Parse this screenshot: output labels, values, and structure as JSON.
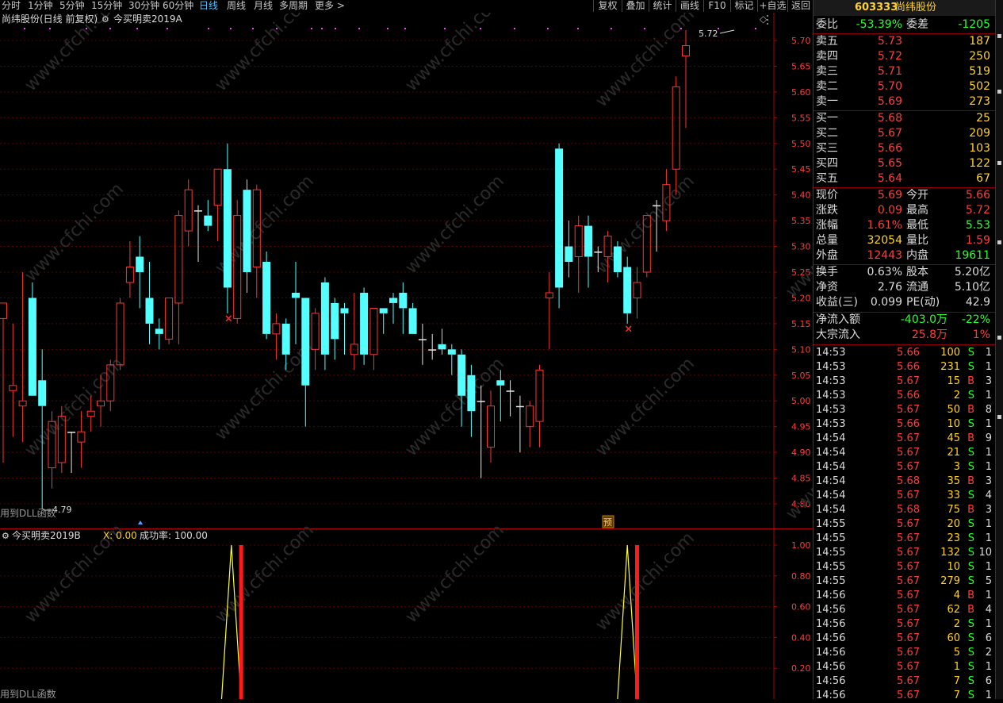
{
  "toolbar": {
    "periods": [
      "分时",
      "1分钟",
      "5分钟",
      "15分钟",
      "30分钟",
      "60分钟",
      "日线",
      "周线",
      "月线",
      "多周期",
      "更多 >"
    ],
    "active_period": "日线",
    "buttons": [
      "复权",
      "叠加",
      "统计",
      "画线",
      "F10",
      "标记",
      "+自选",
      "返回"
    ]
  },
  "main_chart": {
    "title": "尚纬股份(日线 前复权)",
    "indicator": "今买明卖2019A",
    "diamond": "◇",
    "x_mark": "×",
    "dll_label": "用到DLL函数",
    "hi_label": "5.72",
    "lo_label": "4.79",
    "yu_badge": "预"
  },
  "sub_chart": {
    "title": "今买明卖2019B",
    "x_label": "X: 0.00",
    "success_label": "成功率: 100.00",
    "dll_label": "用到DLL函数"
  },
  "chart_data": [
    {
      "type": "candlestick",
      "title": "尚纬股份(日线 前复权)",
      "ylim": [
        4.75,
        5.77
      ],
      "yticks": [
        "5.70",
        "5.65",
        "5.60",
        "5.55",
        "5.50",
        "5.45",
        "5.40",
        "5.35",
        "5.30",
        "5.25",
        "5.20",
        "5.15",
        "5.10",
        "5.05",
        "5.00",
        "4.95",
        "4.90",
        "4.85",
        "4.80"
      ],
      "colors": {
        "up": "#ff3232",
        "down": "#54ffff",
        "flat": "#e6e6e6"
      },
      "candles": [
        {
          "o": 5.16,
          "h": 5.19,
          "l": 4.88,
          "c": 5.19
        },
        {
          "o": 5.02,
          "h": 5.15,
          "l": 4.93,
          "c": 5.03
        },
        {
          "o": 4.99,
          "h": 5.25,
          "l": 4.92,
          "c": 5.0
        },
        {
          "o": 5.2,
          "h": 5.23,
          "l": 5.01,
          "c": 5.01
        },
        {
          "o": 5.04,
          "h": 5.1,
          "l": 4.79,
          "c": 4.99
        },
        {
          "o": 4.87,
          "h": 4.98,
          "l": 4.83,
          "c": 4.96
        },
        {
          "o": 4.88,
          "h": 4.99,
          "l": 4.86,
          "c": 4.97
        },
        {
          "o": 4.94,
          "h": 4.94,
          "l": 4.86,
          "c": 4.94
        },
        {
          "o": 4.92,
          "h": 4.98,
          "l": 4.87,
          "c": 4.94
        },
        {
          "o": 4.97,
          "h": 5.01,
          "l": 4.94,
          "c": 4.98
        },
        {
          "o": 4.99,
          "h": 5.05,
          "l": 4.95,
          "c": 5.0
        },
        {
          "o": 5.0,
          "h": 5.08,
          "l": 4.98,
          "c": 5.07
        },
        {
          "o": 5.07,
          "h": 5.2,
          "l": 5.06,
          "c": 5.19
        },
        {
          "o": 5.23,
          "h": 5.31,
          "l": 5.2,
          "c": 5.26
        },
        {
          "o": 5.28,
          "h": 5.32,
          "l": 5.18,
          "c": 5.25
        },
        {
          "o": 5.2,
          "h": 5.27,
          "l": 5.11,
          "c": 5.15
        },
        {
          "o": 5.14,
          "h": 5.16,
          "l": 5.1,
          "c": 5.13
        },
        {
          "o": 5.12,
          "h": 5.2,
          "l": 5.11,
          "c": 5.2
        },
        {
          "o": 5.19,
          "h": 5.37,
          "l": 5.11,
          "c": 5.36
        },
        {
          "o": 5.33,
          "h": 5.43,
          "l": 5.3,
          "c": 5.41
        },
        {
          "o": 5.37,
          "h": 5.38,
          "l": 5.27,
          "c": 5.37
        },
        {
          "o": 5.36,
          "h": 5.39,
          "l": 5.33,
          "c": 5.34
        },
        {
          "o": 5.38,
          "h": 5.45,
          "l": 5.31,
          "c": 5.45
        },
        {
          "o": 5.45,
          "h": 5.5,
          "l": 5.17,
          "c": 5.22
        },
        {
          "o": 5.16,
          "h": 5.39,
          "l": 5.15,
          "c": 5.36
        },
        {
          "o": 5.41,
          "h": 5.43,
          "l": 5.21,
          "c": 5.25
        },
        {
          "o": 5.26,
          "h": 5.42,
          "l": 5.2,
          "c": 5.41
        },
        {
          "o": 5.27,
          "h": 5.29,
          "l": 5.12,
          "c": 5.13
        },
        {
          "o": 5.13,
          "h": 5.17,
          "l": 5.08,
          "c": 5.15
        },
        {
          "o": 5.15,
          "h": 5.16,
          "l": 5.06,
          "c": 5.09
        },
        {
          "o": 5.21,
          "h": 5.27,
          "l": 5.11,
          "c": 5.2
        },
        {
          "o": 5.2,
          "h": 5.2,
          "l": 4.95,
          "c": 5.03
        },
        {
          "o": 5.1,
          "h": 5.18,
          "l": 5.06,
          "c": 5.17
        },
        {
          "o": 5.23,
          "h": 5.24,
          "l": 5.06,
          "c": 5.09
        },
        {
          "o": 5.19,
          "h": 5.2,
          "l": 5.08,
          "c": 5.12
        },
        {
          "o": 5.18,
          "h": 5.19,
          "l": 5.09,
          "c": 5.17
        },
        {
          "o": 5.09,
          "h": 5.21,
          "l": 5.06,
          "c": 5.11
        },
        {
          "o": 5.21,
          "h": 5.22,
          "l": 5.07,
          "c": 5.09
        },
        {
          "o": 5.09,
          "h": 5.18,
          "l": 5.06,
          "c": 5.18
        },
        {
          "o": 5.18,
          "h": 5.18,
          "l": 5.13,
          "c": 5.17
        },
        {
          "o": 5.2,
          "h": 5.21,
          "l": 5.15,
          "c": 5.19
        },
        {
          "o": 5.21,
          "h": 5.23,
          "l": 5.13,
          "c": 5.18
        },
        {
          "o": 5.18,
          "h": 5.19,
          "l": 5.13,
          "c": 5.13
        },
        {
          "o": 5.12,
          "h": 5.15,
          "l": 5.07,
          "c": 5.12
        },
        {
          "o": 5.1,
          "h": 5.13,
          "l": 5.08,
          "c": 5.1
        },
        {
          "o": 5.11,
          "h": 5.14,
          "l": 5.09,
          "c": 5.1
        },
        {
          "o": 5.1,
          "h": 5.11,
          "l": 5.05,
          "c": 5.09
        },
        {
          "o": 5.09,
          "h": 5.1,
          "l": 4.95,
          "c": 5.01
        },
        {
          "o": 5.05,
          "h": 5.07,
          "l": 4.93,
          "c": 4.98
        },
        {
          "o": 5.0,
          "h": 5.03,
          "l": 4.85,
          "c": 5.0
        },
        {
          "o": 4.91,
          "h": 5.02,
          "l": 4.88,
          "c": 4.99
        },
        {
          "o": 5.04,
          "h": 5.06,
          "l": 4.96,
          "c": 5.03
        },
        {
          "o": 5.02,
          "h": 5.04,
          "l": 4.97,
          "c": 5.02
        },
        {
          "o": 4.99,
          "h": 5.01,
          "l": 4.9,
          "c": 4.99
        },
        {
          "o": 4.95,
          "h": 5.0,
          "l": 4.91,
          "c": 4.99
        },
        {
          "o": 4.96,
          "h": 5.07,
          "l": 4.91,
          "c": 5.06
        },
        {
          "o": 5.2,
          "h": 5.25,
          "l": 5.1,
          "c": 5.21
        },
        {
          "o": 5.49,
          "h": 5.5,
          "l": 5.18,
          "c": 5.22
        },
        {
          "o": 5.3,
          "h": 5.35,
          "l": 5.24,
          "c": 5.27
        },
        {
          "o": 5.28,
          "h": 5.36,
          "l": 5.21,
          "c": 5.34
        },
        {
          "o": 5.34,
          "h": 5.36,
          "l": 5.22,
          "c": 5.28
        },
        {
          "o": 5.29,
          "h": 5.3,
          "l": 5.25,
          "c": 5.29
        },
        {
          "o": 5.28,
          "h": 5.33,
          "l": 5.23,
          "c": 5.32
        },
        {
          "o": 5.3,
          "h": 5.31,
          "l": 5.24,
          "c": 5.25
        },
        {
          "o": 5.26,
          "h": 5.28,
          "l": 5.15,
          "c": 5.17
        },
        {
          "o": 5.2,
          "h": 5.26,
          "l": 5.16,
          "c": 5.23
        },
        {
          "o": 5.25,
          "h": 5.36,
          "l": 5.24,
          "c": 5.36
        },
        {
          "o": 5.38,
          "h": 5.39,
          "l": 5.29,
          "c": 5.38
        },
        {
          "o": 5.35,
          "h": 5.45,
          "l": 5.33,
          "c": 5.42
        },
        {
          "o": 5.45,
          "h": 5.63,
          "l": 5.4,
          "c": 5.61
        },
        {
          "o": 5.67,
          "h": 5.72,
          "l": 5.53,
          "c": 5.69
        }
      ],
      "markers": [
        {
          "type": "x",
          "index": 23,
          "y": 5.16
        },
        {
          "type": "x",
          "index": 64,
          "y": 5.14
        }
      ]
    },
    {
      "type": "line",
      "title": "今买明卖2019B",
      "ylim": [
        0,
        1.0
      ],
      "yticks": [
        "1.00",
        "0.80",
        "0.60",
        "0.40",
        "0.20"
      ],
      "series": [
        {
          "points": [
            {
              "i": 22.4,
              "v": 0
            },
            {
              "i": 23.4,
              "v": 1
            },
            {
              "i": 24.4,
              "v": 0
            }
          ]
        },
        {
          "points": [
            {
              "i": 63.0,
              "v": 0
            },
            {
              "i": 64.0,
              "v": 1
            },
            {
              "i": 65.0,
              "v": 0
            }
          ]
        }
      ],
      "bars": [
        {
          "index": 24.4,
          "value": 1
        },
        {
          "index": 65.0,
          "value": 1
        }
      ]
    }
  ],
  "quote": {
    "code": "603333",
    "name": "尚纬股份",
    "wb_label": "委比",
    "wb_value": "-53.39%",
    "wc_label": "委差",
    "wc_value": "-1205",
    "asks": [
      {
        "label": "卖五",
        "price": "5.73",
        "vol": "187"
      },
      {
        "label": "卖四",
        "price": "5.72",
        "vol": "250"
      },
      {
        "label": "卖三",
        "price": "5.71",
        "vol": "519"
      },
      {
        "label": "卖二",
        "price": "5.70",
        "vol": "502"
      },
      {
        "label": "卖一",
        "price": "5.69",
        "vol": "273"
      }
    ],
    "bids": [
      {
        "label": "买一",
        "price": "5.68",
        "vol": "25"
      },
      {
        "label": "买二",
        "price": "5.67",
        "vol": "209"
      },
      {
        "label": "买三",
        "price": "5.66",
        "vol": "103"
      },
      {
        "label": "买四",
        "price": "5.65",
        "vol": "122"
      },
      {
        "label": "买五",
        "price": "5.64",
        "vol": "67"
      }
    ],
    "stats": [
      {
        "l1": "现价",
        "v1": "5.69",
        "c1": "red",
        "l2": "今开",
        "v2": "5.66",
        "c2": "red"
      },
      {
        "l1": "涨跌",
        "v1": "0.09",
        "c1": "red",
        "l2": "最高",
        "v2": "5.72",
        "c2": "red"
      },
      {
        "l1": "涨幅",
        "v1": "1.61%",
        "c1": "red",
        "l2": "最低",
        "v2": "5.53",
        "c2": "green"
      },
      {
        "l1": "总量",
        "v1": "32054",
        "c1": "yel",
        "l2": "量比",
        "v2": "1.59",
        "c2": "red"
      },
      {
        "l1": "外盘",
        "v1": "12443",
        "c1": "red",
        "l2": "内盘",
        "v2": "19611",
        "c2": "green"
      }
    ],
    "fundamentals": [
      {
        "l1": "换手",
        "v1": "0.63%",
        "l2": "股本",
        "v2": "5.20亿"
      },
      {
        "l1": "净资",
        "v1": "2.76",
        "l2": "流通",
        "v2": "5.10亿"
      },
      {
        "l1": "收益(三)",
        "v1": "0.099",
        "l2": "PE(动)",
        "v2": "42.9"
      }
    ],
    "flow": [
      {
        "label": "净流入额",
        "v1": "-403.0万",
        "c1": "green",
        "v2": "-22%",
        "c2": "green"
      },
      {
        "label": "大宗流入",
        "v1": "25.8万",
        "c1": "red",
        "v2": "1%",
        "c2": "red"
      }
    ],
    "trades": [
      {
        "t": "14:53",
        "p": "5.66",
        "v": "100",
        "s": "S",
        "n": "1"
      },
      {
        "t": "14:53",
        "p": "5.66",
        "v": "231",
        "s": "S",
        "n": "1"
      },
      {
        "t": "14:53",
        "p": "5.67",
        "v": "15",
        "s": "B",
        "n": "3"
      },
      {
        "t": "14:53",
        "p": "5.66",
        "v": "2",
        "s": "S",
        "n": "1"
      },
      {
        "t": "14:53",
        "p": "5.67",
        "v": "50",
        "s": "B",
        "n": "8"
      },
      {
        "t": "14:53",
        "p": "5.66",
        "v": "10",
        "s": "S",
        "n": "1"
      },
      {
        "t": "14:54",
        "p": "5.67",
        "v": "45",
        "s": "B",
        "n": "9"
      },
      {
        "t": "14:54",
        "p": "5.67",
        "v": "21",
        "s": "S",
        "n": "1"
      },
      {
        "t": "14:54",
        "p": "5.67",
        "v": "3",
        "s": "S",
        "n": "1"
      },
      {
        "t": "14:54",
        "p": "5.68",
        "v": "35",
        "s": "B",
        "n": "3"
      },
      {
        "t": "14:54",
        "p": "5.67",
        "v": "33",
        "s": "S",
        "n": "4"
      },
      {
        "t": "14:54",
        "p": "5.68",
        "v": "75",
        "s": "B",
        "n": "3"
      },
      {
        "t": "14:55",
        "p": "5.67",
        "v": "20",
        "s": "S",
        "n": "1"
      },
      {
        "t": "14:55",
        "p": "5.67",
        "v": "23",
        "s": "S",
        "n": "1"
      },
      {
        "t": "14:55",
        "p": "5.67",
        "v": "132",
        "s": "S",
        "n": "10"
      },
      {
        "t": "14:55",
        "p": "5.67",
        "v": "10",
        "s": "S",
        "n": "1"
      },
      {
        "t": "14:55",
        "p": "5.67",
        "v": "279",
        "s": "S",
        "n": "5"
      },
      {
        "t": "14:56",
        "p": "5.67",
        "v": "4",
        "s": "B",
        "n": "1"
      },
      {
        "t": "14:56",
        "p": "5.67",
        "v": "62",
        "s": "B",
        "n": "4"
      },
      {
        "t": "14:56",
        "p": "5.67",
        "v": "2",
        "s": "S",
        "n": "1"
      },
      {
        "t": "14:56",
        "p": "5.67",
        "v": "60",
        "s": "S",
        "n": "6"
      },
      {
        "t": "14:56",
        "p": "5.67",
        "v": "5",
        "s": "S",
        "n": "2"
      },
      {
        "t": "14:56",
        "p": "5.67",
        "v": "1",
        "s": "S",
        "n": "1"
      },
      {
        "t": "14:56",
        "p": "5.67",
        "v": "7",
        "s": "S",
        "n": "6"
      },
      {
        "t": "14:56",
        "p": "5.67",
        "v": "7",
        "s": "S",
        "n": "1"
      }
    ]
  },
  "watermark": "www.cfchi.com"
}
